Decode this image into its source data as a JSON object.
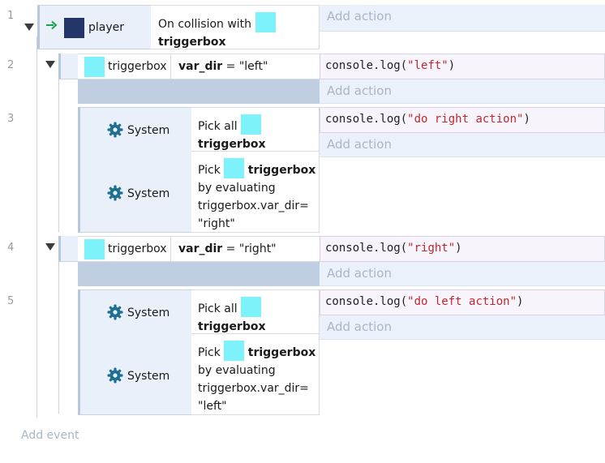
{
  "add_action": "Add action",
  "add_event": "Add event",
  "events": [
    {
      "number": "1",
      "object": "player",
      "condition": {
        "prefix": "On collision with",
        "target": "triggerbox"
      }
    },
    {
      "number": "2",
      "object": "triggerbox",
      "variable": "var_dir",
      "operator": "=",
      "value": "\"left\"",
      "action": {
        "call": "console.log(",
        "arg": "\"left\"",
        "close": ")"
      }
    },
    {
      "number": "3",
      "system_label": "System",
      "pick_all": {
        "word": "Pick all",
        "target": "triggerbox"
      },
      "pick_eval": {
        "word": "Pick",
        "target": "triggerbox",
        "line2": "by evaluating",
        "line3": "triggerbox.var_dir=",
        "line4": "\"right\""
      },
      "action": {
        "call": "console.log(",
        "arg": "\"do right action\"",
        "close": ")"
      }
    },
    {
      "number": "4",
      "object": "triggerbox",
      "variable": "var_dir",
      "operator": "=",
      "value": "\"right\"",
      "action": {
        "call": "console.log(",
        "arg": "\"right\"",
        "close": ")"
      }
    },
    {
      "number": "5",
      "system_label": "System",
      "pick_all": {
        "word": "Pick all",
        "target": "triggerbox"
      },
      "pick_eval": {
        "word": "Pick",
        "target": "triggerbox",
        "line2": "by evaluating",
        "line3": "triggerbox.var_dir=",
        "line4": "\"left\""
      },
      "action": {
        "call": "console.log(",
        "arg": "\"do left action\"",
        "close": ")"
      }
    }
  ],
  "colors": {
    "accent": "#1f6f8f",
    "object_swatch": "#7df2fa",
    "player_swatch": "#243569",
    "string": "#c1272d",
    "trigger_arrow": "#1aa34a"
  },
  "icons": [
    "collapse-triangle-icon",
    "gear-icon",
    "trigger-arrow-icon"
  ]
}
